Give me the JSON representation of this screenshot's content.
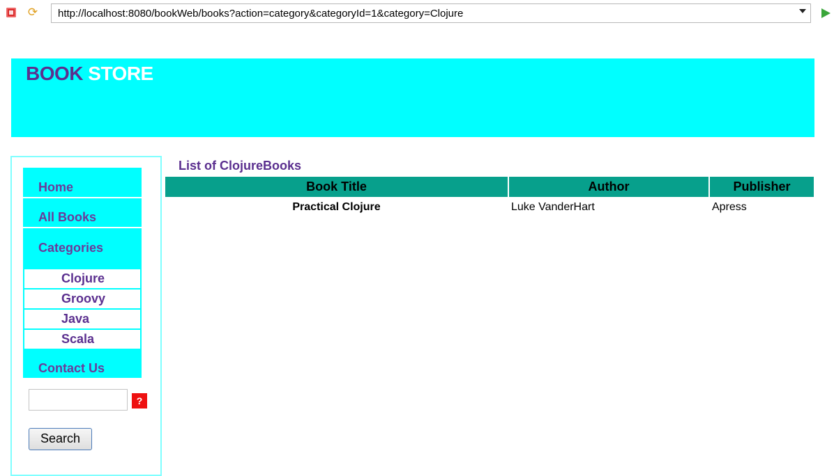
{
  "browser": {
    "url": "http://localhost:8080/bookWeb/books?action=category&categoryId=1&category=Clojure",
    "stop_icon": "stop-icon",
    "refresh_icon": "refresh-icon",
    "go_icon": "go-arrow-icon"
  },
  "header": {
    "brand_part1": "BOOK",
    "brand_part2": "STORE"
  },
  "sidebar": {
    "nav": {
      "home": "Home",
      "all_books": "All Books",
      "categories": "Categories",
      "contact": "Contact Us"
    },
    "categories": [
      "Clojure",
      "Groovy",
      "Java",
      "Scala"
    ],
    "search_value": "",
    "help_icon_glyph": "?",
    "search_button": "Search"
  },
  "content": {
    "list_title": "List of ClojureBooks",
    "columns": [
      "Book Title",
      "Author",
      "Publisher"
    ],
    "rows": [
      [
        "Practical Clojure",
        "Luke VanderHart",
        "Apress"
      ]
    ]
  },
  "colors": {
    "banner": "#00ffff",
    "brand_dark": "#5b2f8f",
    "table_header": "#07a08c"
  }
}
